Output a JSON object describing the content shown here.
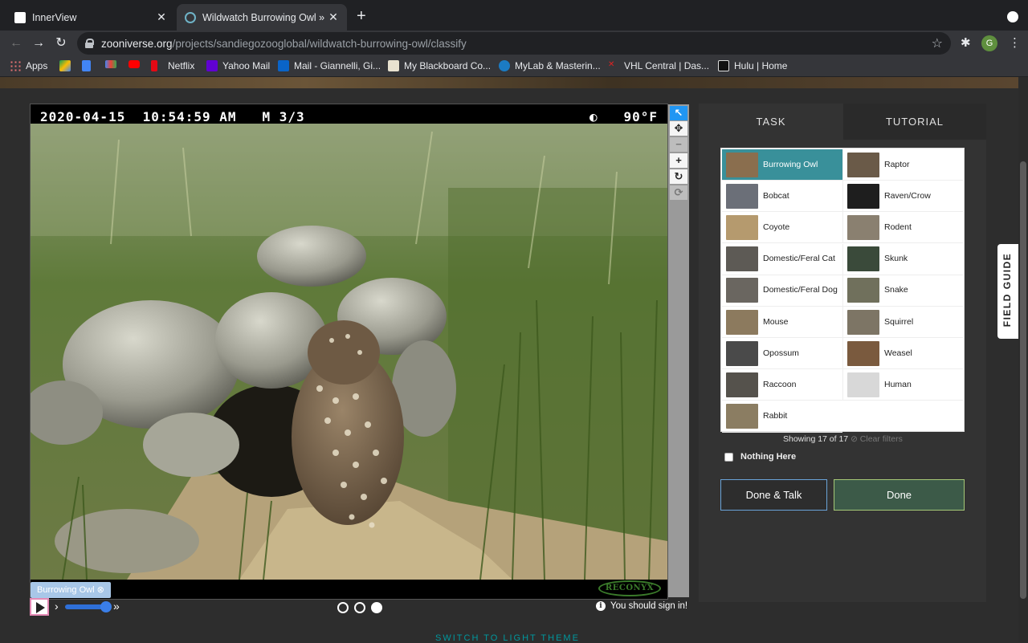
{
  "browser": {
    "tabs": [
      {
        "title": "InnerView",
        "active": false
      },
      {
        "title": "Wildwatch Burrowing Owl » Cl",
        "active": true
      }
    ],
    "url_host": "zooniverse.org",
    "url_path": "/projects/sandiegozooglobal/wildwatch-burrowing-owl/classify",
    "profile_initial": "G",
    "bookmarks": [
      "Apps",
      "",
      "",
      "",
      "",
      "Netflix",
      "Yahoo Mail",
      "Mail - Giannelli, Gi...",
      "My Blackboard Co...",
      "MyLab & Masterin...",
      "VHL Central | Das...",
      "Hulu | Home"
    ]
  },
  "viewer": {
    "timestamp": "2020-04-15  10:54:59 AM   M 3/3",
    "temperature": "◐   90°F",
    "camera_brand": "RECONYX",
    "tag_label": "Burrowing Owl",
    "sign_in_notice": "You should sign in!",
    "frame_current": 3,
    "frame_total": 3
  },
  "tools": [
    "pointer",
    "move",
    "zoom-out",
    "zoom-in",
    "rotate",
    "reset"
  ],
  "task_panel": {
    "tabs": [
      "TASK",
      "TUTORIAL"
    ],
    "choices_left": [
      {
        "label": "Burrowing Owl",
        "selected": true,
        "color": "#8a6e4e"
      },
      {
        "label": "Bobcat",
        "color": "#6b6f78"
      },
      {
        "label": "Coyote",
        "color": "#b59a6e"
      },
      {
        "label": "Domestic/Feral Cat",
        "color": "#5d5a55"
      },
      {
        "label": "Domestic/Feral Dog",
        "color": "#6a6660"
      },
      {
        "label": "Mouse",
        "color": "#8c7a5e"
      },
      {
        "label": "Opossum",
        "color": "#4a4a4a"
      },
      {
        "label": "Raccoon",
        "color": "#55524c"
      },
      {
        "label": "Rabbit",
        "color": "#8b7d62"
      }
    ],
    "choices_right": [
      {
        "label": "Raptor",
        "color": "#6a5a48"
      },
      {
        "label": "Raven/Crow",
        "color": "#1e1e1e"
      },
      {
        "label": "Rodent",
        "color": "#8a8070"
      },
      {
        "label": "Skunk",
        "color": "#3a4a3a"
      },
      {
        "label": "Snake",
        "color": "#70705c"
      },
      {
        "label": "Squirrel",
        "color": "#7d7565"
      },
      {
        "label": "Weasel",
        "color": "#7a5a3e"
      },
      {
        "label": "Human",
        "color": "#d8d8d8"
      }
    ],
    "showing_text": "Showing 17 of 17",
    "clear_filters": "⊘ Clear filters",
    "nothing_here": "Nothing Here",
    "done_talk": "Done & Talk",
    "done": "Done"
  },
  "field_guide": "FIELD GUIDE",
  "theme_toggle": "SWITCH TO LIGHT THEME"
}
